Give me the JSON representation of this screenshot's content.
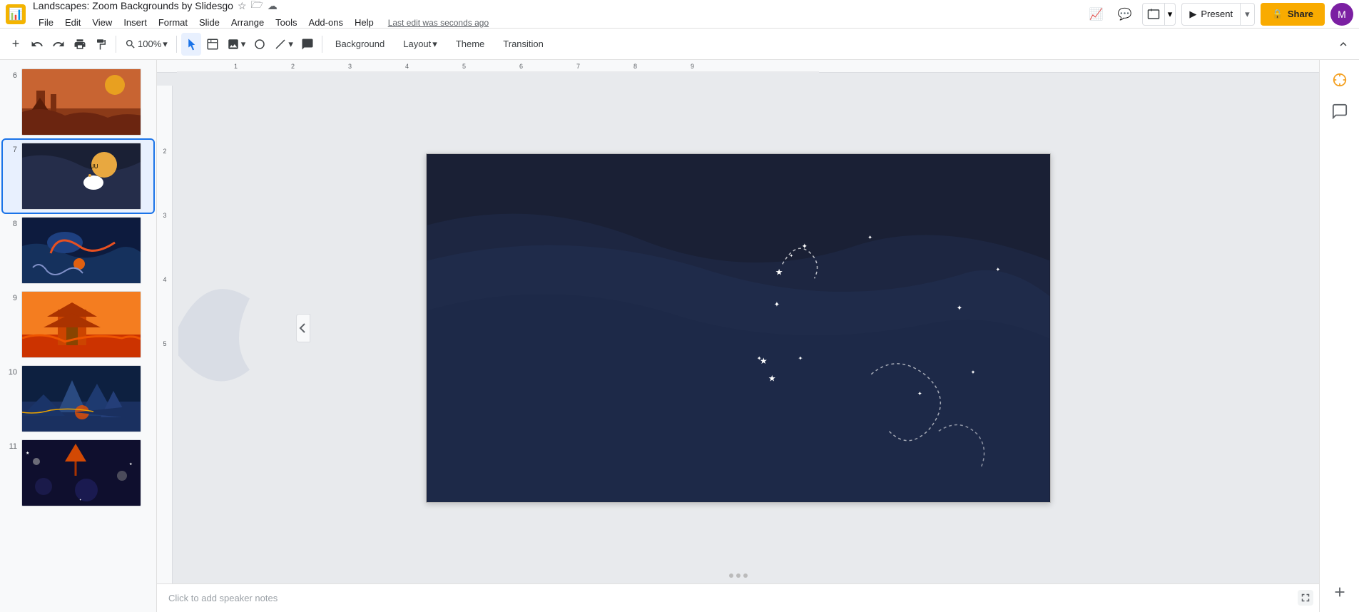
{
  "app": {
    "icon": "📊",
    "title": "Landscapes: Zoom Backgrounds by Slidesgo",
    "save_status": "Last edit was seconds ago"
  },
  "menu": {
    "items": [
      "File",
      "Edit",
      "View",
      "Insert",
      "Format",
      "Slide",
      "Arrange",
      "Tools",
      "Add-ons",
      "Help"
    ]
  },
  "toolbar": {
    "zoom": "100%",
    "background_label": "Background",
    "layout_label": "Layout",
    "theme_label": "Theme",
    "transition_label": "Transition"
  },
  "topRight": {
    "present_label": "Present",
    "share_label": "🔒 Share",
    "avatar_initials": "M"
  },
  "slides": [
    {
      "num": "6",
      "type": "desert"
    },
    {
      "num": "7",
      "type": "space",
      "active": true
    },
    {
      "num": "8",
      "type": "underwater"
    },
    {
      "num": "9",
      "type": "pagoda"
    },
    {
      "num": "10",
      "type": "mountain"
    },
    {
      "num": "11",
      "type": "space2"
    }
  ],
  "notes": {
    "placeholder": "Click to add speaker notes"
  },
  "ruler": {
    "ticks": [
      "1",
      "2",
      "3",
      "4",
      "5",
      "6",
      "7",
      "8",
      "9"
    ]
  }
}
